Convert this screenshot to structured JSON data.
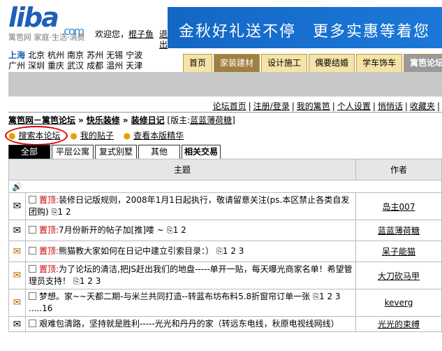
{
  "logo": {
    "word": "liba",
    "dotcom": ".com",
    "slogan": "篱笆网 家庭·生活·消费"
  },
  "welcome": {
    "text": "欢迎您，",
    "username": "棍子鱼",
    "exit": "退出"
  },
  "cities": {
    "row1": [
      "上海",
      "北京",
      "杭州",
      "南京",
      "苏州",
      "无锡",
      "宁波"
    ],
    "row2": [
      "广州",
      "深圳",
      "重庆",
      "武汉",
      "成都",
      "温州",
      "天津"
    ],
    "current": "上海"
  },
  "banner": {
    "text": "金秋好礼送不停　更多实惠等着您"
  },
  "navtabs": [
    "首页",
    "家装建材",
    "设计施工",
    "偶要结婚",
    "学车饰车",
    "篱笆论坛"
  ],
  "forum_links": [
    "论坛首页",
    "注册/登录",
    "我的篱笆",
    "个人设置",
    "悄悄话",
    "收藏夹"
  ],
  "breadcrumb": {
    "site": "篱笆网－篱笆论坛",
    "level1": "快乐装修",
    "level2": "装修日记",
    "moderator_prefix": "[版主:",
    "moderator": "蓝蓝薄荷糖",
    "moderator_suffix": "]"
  },
  "actions": [
    "搜索本论坛",
    "我的贴子",
    "查看本版精华"
  ],
  "subtabs": [
    "全部",
    "平层公寓",
    "复式别墅",
    "其他",
    "相关交易"
  ],
  "table": {
    "header_topic": "主题",
    "header_author": "作者",
    "rows": [
      {
        "sticky": "置顶:",
        "title": "装修日记版规则，2008年1月1日起执行，敬请留意关注(ps.本区禁止各类自发团购)",
        "pages": "1 2",
        "author": "岛主007"
      },
      {
        "sticky": "置顶:",
        "title": "7月份新开的帖子加[推]喽 ~",
        "pages": "1 2",
        "author": "蓝蓝薄荷糖"
      },
      {
        "sticky": "置顶:",
        "title": "熊猫教大家如何在日记中建立引索目录：）",
        "pages": "1 2 3",
        "author": "呆子能猫"
      },
      {
        "sticky": "置顶:",
        "title": "为了论坛的清洁,把JS赶出我们的地盘-----单开一贴，每天曝光商家名单！希望管理员支持！",
        "pages": "1 2 3",
        "author": "大刀砍马甲"
      },
      {
        "sticky": "",
        "title": "梦想。家~~天都二期-与米兰共同打造--转蓝布坊布料5.8折窗帘订单一张",
        "pages": "1 2 3 .....16",
        "author": "keverg"
      },
      {
        "sticky": "",
        "title": "艰难包清路，坚持就是胜利-----光光和丹丹的家（转远东电线，秋原电视线网线）",
        "pages": "",
        "author": "光光的束缚"
      }
    ]
  }
}
